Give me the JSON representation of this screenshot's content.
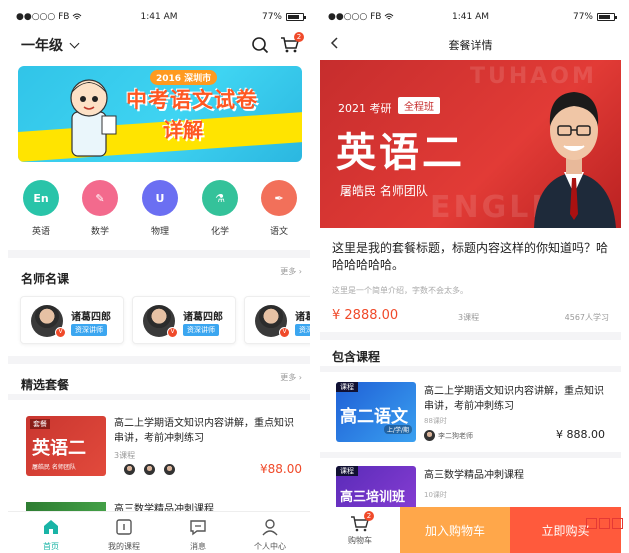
{
  "status": {
    "carrier": "●●○○○ FB",
    "time": "1:41 AM",
    "battery": "77%"
  },
  "home": {
    "grade_selector": "一年级",
    "cart_badge": "2",
    "banner": {
      "year_tag": "2016 深圳市",
      "title_line1": "中考语文试卷",
      "title_line2": "详解"
    },
    "subjects": [
      {
        "label": "英语",
        "icon_text": "En",
        "color": "#29c4a9"
      },
      {
        "label": "数学",
        "icon_text": "✎",
        "color": "#f36a8d"
      },
      {
        "label": "物理",
        "icon_text": "U",
        "color": "#6b6ff2"
      },
      {
        "label": "化学",
        "icon_text": "⚗",
        "color": "#34c29a"
      },
      {
        "label": "语文",
        "icon_text": "✒",
        "color": "#f2705a"
      }
    ],
    "teachers_section": {
      "title": "名师名课",
      "more": "更多 ›",
      "teachers": [
        {
          "name": "诸葛四郎",
          "tag": "资深讲师"
        },
        {
          "name": "诸葛四郎",
          "tag": "资深讲师"
        },
        {
          "name": "诸葛四郎",
          "tag": "资深讲师"
        }
      ]
    },
    "packages_section": {
      "title": "精选套餐",
      "more": "更多 ›",
      "items": [
        {
          "thumb_tag": "套餐",
          "thumb_big": "英语二",
          "thumb_sub": "屠皓民  名师团队",
          "title": "高二上学期语文知识内容讲解，重点知识串讲，考前冲刺练习",
          "hours": "3课程",
          "price": "¥88.00"
        },
        {
          "title": "高三数学精品冲刺课程"
        }
      ]
    },
    "tabs": [
      {
        "label": "首页",
        "icon": "home-icon"
      },
      {
        "label": "我的课程",
        "icon": "course-icon"
      },
      {
        "label": "消息",
        "icon": "message-icon"
      },
      {
        "label": "个人中心",
        "icon": "person-icon"
      }
    ],
    "accent_color": "#19b4a6"
  },
  "detail": {
    "nav_title": "套餐详情",
    "hero": {
      "watermark_top": "TUHAOM",
      "watermark_bottom": "ENGLISH",
      "year": "2021 考研",
      "class_tag": "全程班",
      "big_title": "英语二",
      "subtitle": "屠皓民  名师团队"
    },
    "title": "这里是我的套餐标题，标题内容这样的你知道吗？哈哈哈哈哈哈。",
    "description": "这里是一个简单介绍，字数不会太多。",
    "price": "¥ 2888.00",
    "course_count": "3课程",
    "students": "4567人学习",
    "included_title": "包含课程",
    "courses": [
      {
        "thumb_tag": "课程",
        "thumb_big": "高二语文",
        "thumb_sub": "上/学/期",
        "title": "高二上学期语文知识内容讲解，重点知识串讲，考前冲刺练习",
        "hours": "88课时",
        "teacher": "李二狗老师",
        "price": "¥ 888.00"
      },
      {
        "thumb_tag": "课程",
        "thumb_big": "高三培训班",
        "title": "高三数学精品冲刺课程",
        "hours": "10课时"
      }
    ],
    "cart_label": "购物车",
    "cart_badge": "2",
    "add_to_cart": "加入购物车",
    "buy_now": "立即购买"
  }
}
